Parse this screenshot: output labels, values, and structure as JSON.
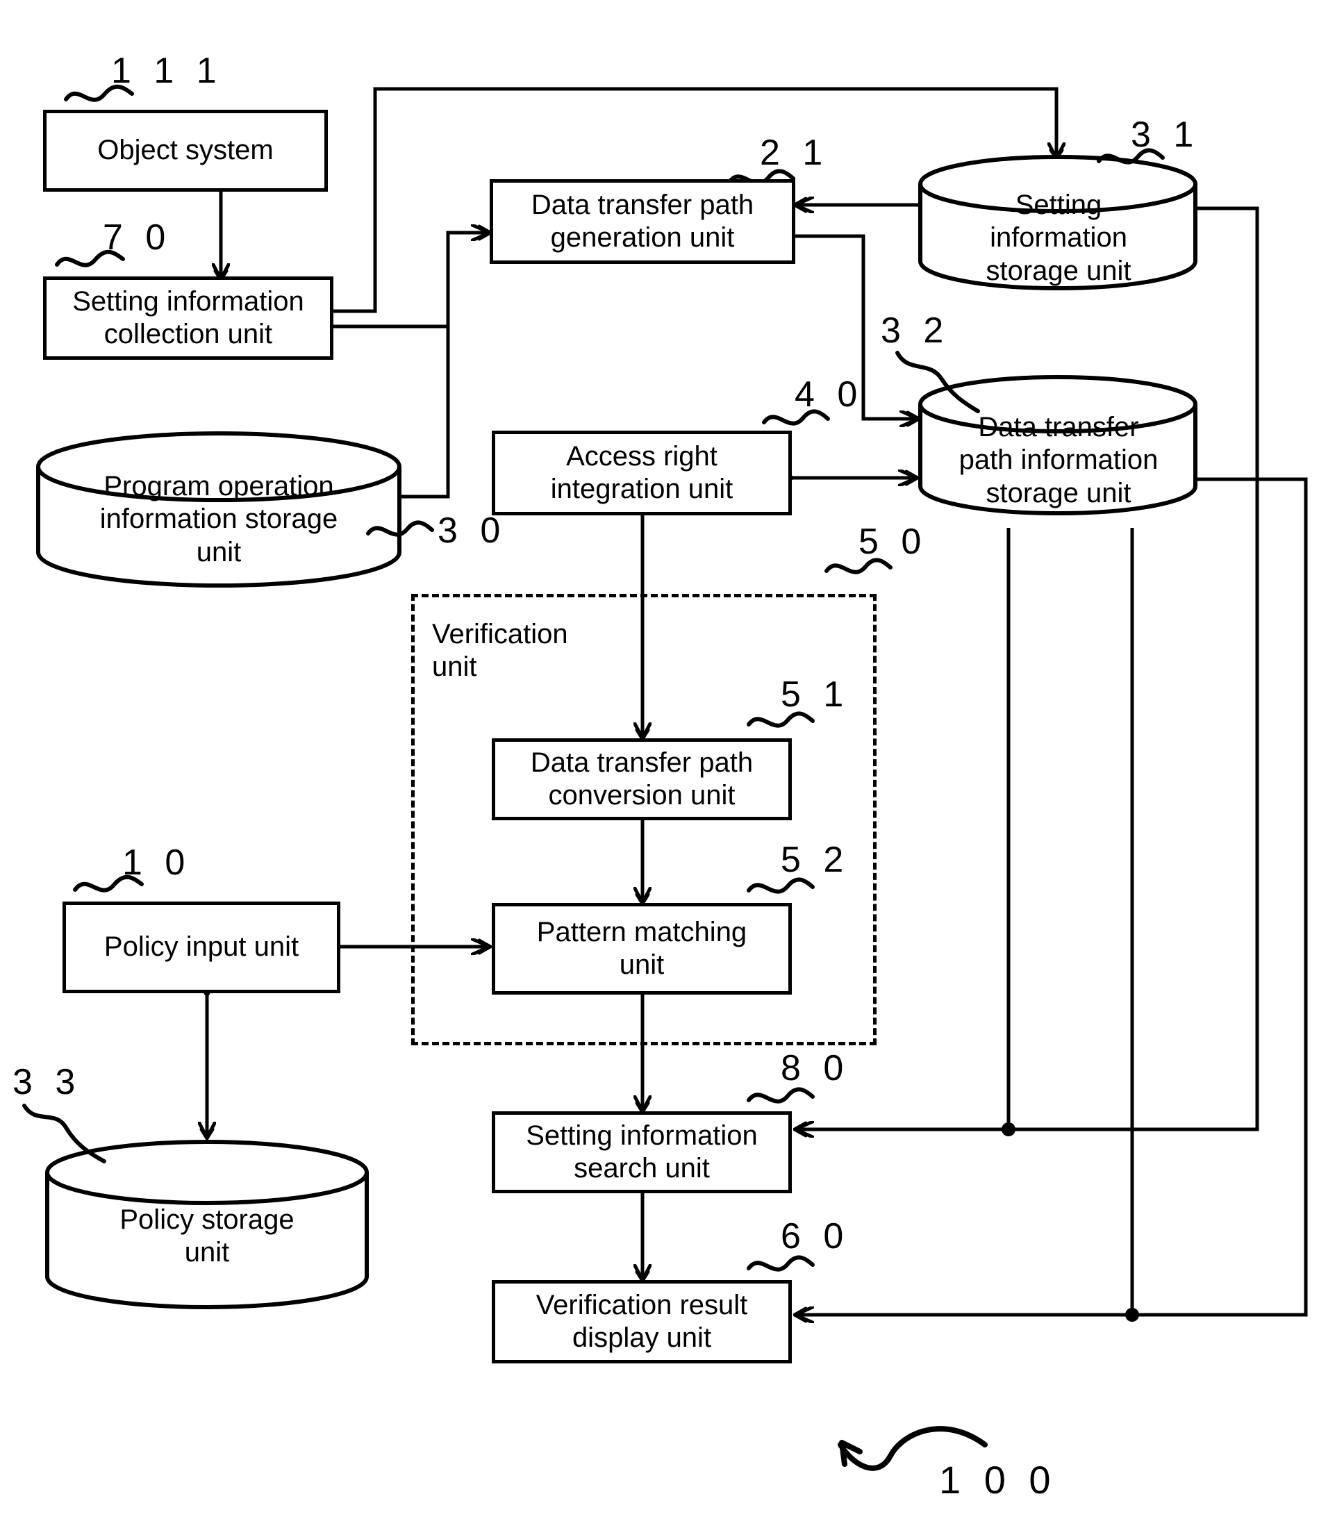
{
  "figure": {
    "type": "patent-block-diagram",
    "overall_ref": "1 0 0",
    "background": "#ffffff",
    "line_color": "#000000"
  },
  "nodes": {
    "object_system": {
      "label": "Object system",
      "ref": "1 1 1",
      "shape": "box"
    },
    "setting_info_collection": {
      "label": "Setting information\ncollection unit",
      "ref": "7 0",
      "shape": "box"
    },
    "program_op_storage": {
      "label": "Program operation\ninformation storage\nunit",
      "ref": "3 0",
      "shape": "cylinder"
    },
    "policy_input": {
      "label": "Policy input unit",
      "ref": "1 0",
      "shape": "box"
    },
    "policy_storage": {
      "label": "Policy storage\nunit",
      "ref": "3 3",
      "shape": "cylinder"
    },
    "path_generation": {
      "label": "Data transfer path\ngeneration unit",
      "ref": "2 1",
      "shape": "box"
    },
    "setting_info_storage": {
      "label": "Setting\ninformation\nstorage unit",
      "ref": "3 1",
      "shape": "cylinder"
    },
    "path_info_storage": {
      "label": "Data transfer\npath information\nstorage unit",
      "ref": "3 2",
      "shape": "cylinder"
    },
    "access_right_integration": {
      "label": "Access right\nintegration unit",
      "ref": "4 0",
      "shape": "box"
    },
    "verification_unit": {
      "label": "Verification\nunit",
      "ref": "5 0",
      "shape": "dashed-group"
    },
    "path_conversion": {
      "label": "Data transfer path\nconversion unit",
      "ref": "5 1",
      "shape": "box"
    },
    "pattern_matching": {
      "label": "Pattern matching\nunit",
      "ref": "5 2",
      "shape": "box"
    },
    "setting_info_search": {
      "label": "Setting information\nsearch unit",
      "ref": "8 0",
      "shape": "box"
    },
    "verification_result_display": {
      "label": "Verification result\ndisplay unit",
      "ref": "6 0",
      "shape": "box"
    }
  },
  "node_lines": {
    "object_system": [
      "Object system"
    ],
    "setting_info_collection": [
      "Setting information",
      "collection unit"
    ],
    "program_op_storage": [
      "Program operation",
      "information storage",
      "unit"
    ],
    "policy_input": [
      "Policy input unit"
    ],
    "policy_storage": [
      "Policy storage",
      "unit"
    ],
    "path_generation": [
      "Data transfer path",
      "generation unit"
    ],
    "setting_info_storage": [
      "Setting",
      "information",
      "storage unit"
    ],
    "path_info_storage": [
      "Data transfer",
      "path information",
      "storage unit"
    ],
    "access_right_integration": [
      "Access right",
      "integration unit"
    ],
    "verification_unit": [
      "Verification",
      "unit"
    ],
    "path_conversion": [
      "Data transfer path",
      "conversion unit"
    ],
    "pattern_matching": [
      "Pattern matching",
      "unit"
    ],
    "setting_info_search": [
      "Setting information",
      "search unit"
    ],
    "verification_result_display": [
      "Verification result",
      "display unit"
    ]
  },
  "refs": {
    "object_system": "1 1 1",
    "setting_info_collection": "7 0",
    "program_op_storage": "3 0",
    "policy_input": "1 0",
    "policy_storage": "3 3",
    "path_generation": "2 1",
    "setting_info_storage": "3 1",
    "path_info_storage": "3 2",
    "access_right_integration": "4 0",
    "verification_unit": "5 0",
    "path_conversion": "5 1",
    "pattern_matching": "5 2",
    "setting_info_search": "8 0",
    "verification_result_display": "6 0",
    "system_overall": "1 0 0"
  },
  "connections": [
    {
      "from": "object_system",
      "to": "setting_info_collection",
      "style": "single-arrow"
    },
    {
      "from": "setting_info_collection",
      "to": "setting_info_storage",
      "style": "single-arrow"
    },
    {
      "from": "setting_info_collection",
      "to": "path_generation",
      "style": "double-arrow-head"
    },
    {
      "from": "program_op_storage",
      "to": "path_generation",
      "style": "double-arrow-head"
    },
    {
      "from": "setting_info_storage",
      "to": "path_generation",
      "style": "double-arrow-head"
    },
    {
      "from": "path_generation",
      "to": "path_info_storage",
      "style": "double-arrow-head"
    },
    {
      "from": "access_right_integration",
      "to": "path_info_storage",
      "style": "bidirectional"
    },
    {
      "from": "access_right_integration",
      "to": "path_conversion",
      "style": "single-arrow"
    },
    {
      "from": "path_conversion",
      "to": "pattern_matching",
      "style": "single-arrow"
    },
    {
      "from": "policy_input",
      "to": "pattern_matching",
      "style": "double-arrow-head"
    },
    {
      "from": "policy_input",
      "to": "policy_storage",
      "style": "bidirectional"
    },
    {
      "from": "pattern_matching",
      "to": "setting_info_search",
      "style": "single-arrow"
    },
    {
      "from": "setting_info_storage",
      "to": "setting_info_search",
      "style": "double-arrow-head"
    },
    {
      "from": "path_info_storage",
      "to": "setting_info_search",
      "style": "junction"
    },
    {
      "from": "setting_info_search",
      "to": "verification_result_display",
      "style": "single-arrow"
    },
    {
      "from": "setting_info_storage",
      "to": "verification_result_display",
      "style": "double-arrow-head"
    },
    {
      "from": "path_info_storage",
      "to": "verification_result_display",
      "style": "junction"
    }
  ]
}
